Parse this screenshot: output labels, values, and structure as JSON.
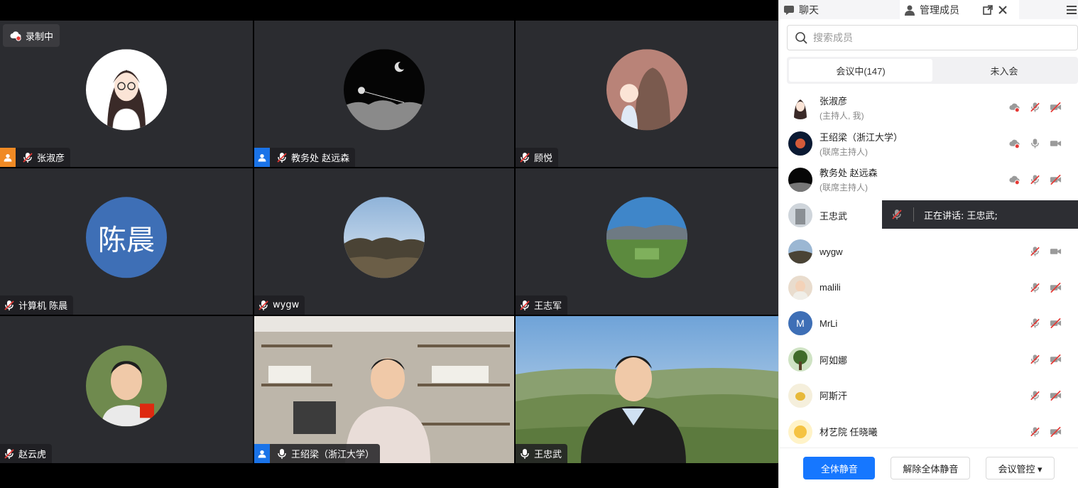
{
  "recording": {
    "label": "录制中"
  },
  "tiles": [
    {
      "name": "张淑彦"
    },
    {
      "name": "教务处 赵远森"
    },
    {
      "name": "顾悦"
    },
    {
      "name": "计算机 陈晨",
      "avatar_text": "陈晨"
    },
    {
      "name": "wygw"
    },
    {
      "name": "王志军"
    },
    {
      "name": "赵云虎"
    },
    {
      "name": "王绍梁（浙江大学）"
    },
    {
      "name": "王忠武"
    }
  ],
  "panel": {
    "tab_chat": "聊天",
    "tab_members": "管理成员",
    "search_placeholder": "搜索成员",
    "seg_in_meeting": "会议中(147)",
    "seg_not_joined": "未入会",
    "members": [
      {
        "name": "张淑彦",
        "role": "(主持人, 我)"
      },
      {
        "name": "王绍梁（浙江大学）",
        "role": "(联席主持人)"
      },
      {
        "name": "教务处 赵远森",
        "role": "(联席主持人)"
      },
      {
        "name": "王忠武",
        "role": ""
      },
      {
        "name": "wygw",
        "role": ""
      },
      {
        "name": "malili",
        "role": ""
      },
      {
        "name": "MrLi",
        "role": "",
        "avatar_text": "M"
      },
      {
        "name": "阿如娜",
        "role": ""
      },
      {
        "name": "阿斯汗",
        "role": ""
      },
      {
        "name": "材艺院 任晓曦",
        "role": ""
      }
    ],
    "speaker_tip": "正在讲话:  王忠武;",
    "btn_mute_all": "全体静音",
    "btn_unmute_all": "解除全体静音",
    "btn_controls": "会议管控 ▾"
  },
  "colors": {
    "accent": "#1677ff",
    "speaking": "#3ec46d",
    "host_orange": "#f08a24",
    "cohost_blue": "#1a73e8",
    "muted_red": "#e53935"
  }
}
